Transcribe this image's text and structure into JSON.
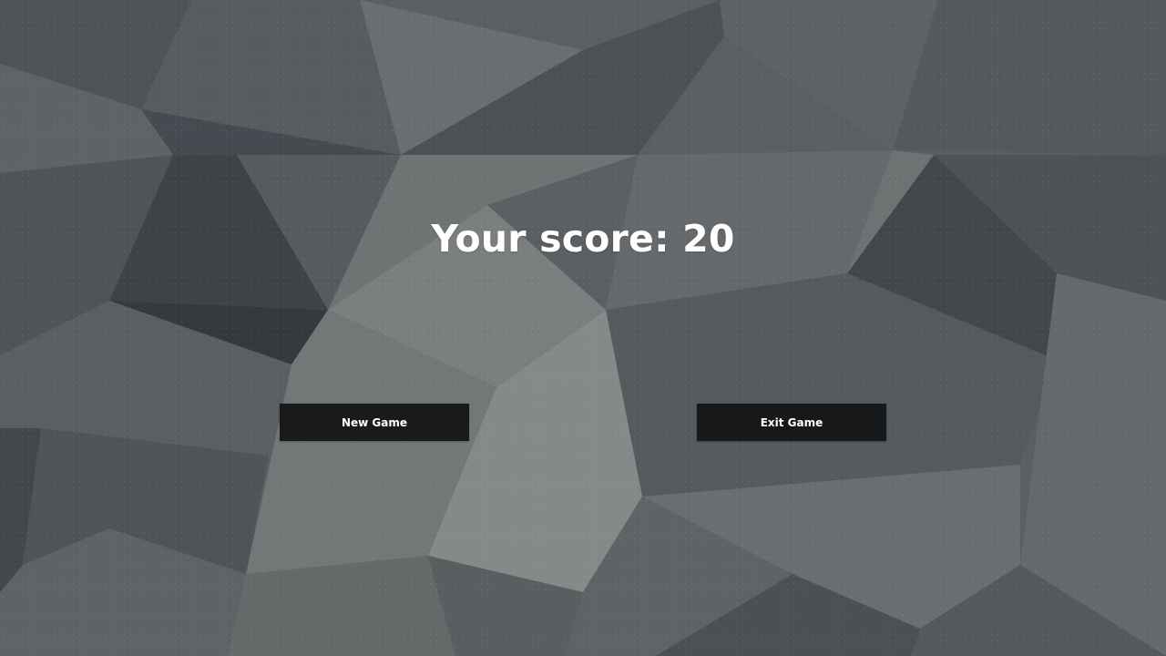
{
  "score_screen": {
    "title": "Your score: 20",
    "score": 20
  },
  "buttons": {
    "new_game_label": "New Game",
    "exit_game_label": "Exit Game"
  },
  "colors": {
    "button_background": "#121213",
    "button_text": "#ffffff",
    "title_text": "#ffffff",
    "background_base": "#5d6061"
  }
}
